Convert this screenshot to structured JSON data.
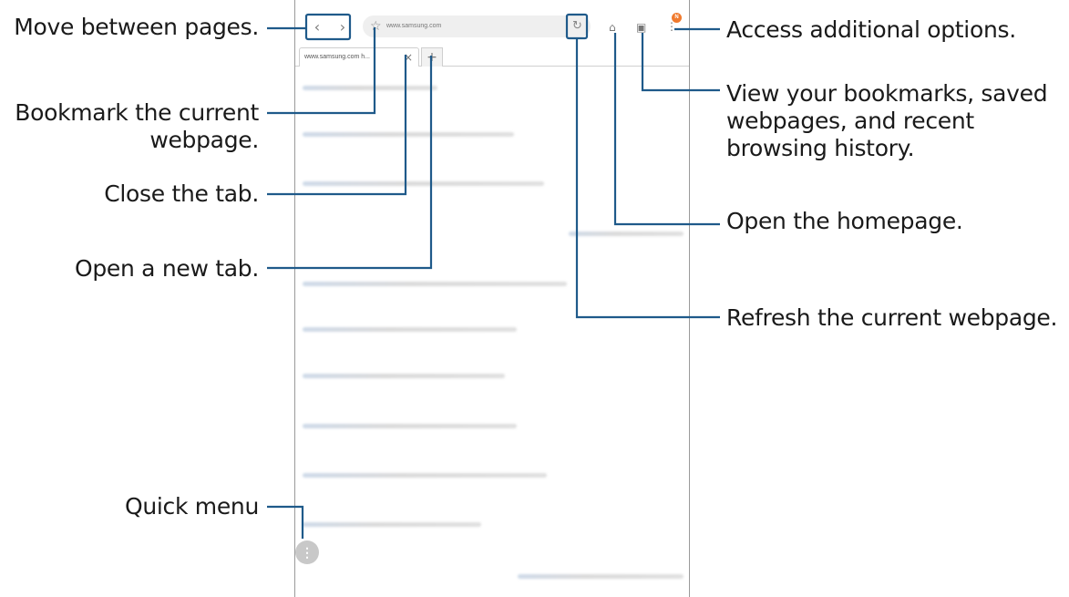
{
  "browser": {
    "url": "www.samsung.com",
    "tab_title": "www.samsung.com  h...",
    "new_tab_symbol": "+",
    "close_tab_symbol": "×",
    "badge_count": "N",
    "icons": [
      "back-icon",
      "forward-icon",
      "bookmark-star-icon",
      "refresh-icon",
      "home-icon",
      "bookmarks-icon",
      "more-options-icon",
      "quick-menu-icon"
    ]
  },
  "callouts": {
    "move_pages": "Move between pages.",
    "bookmark_line1": "Bookmark the current",
    "bookmark_line2": "webpage.",
    "close_tab": "Close the tab.",
    "open_new_tab": "Open a new tab.",
    "quick_menu": "Quick menu",
    "additional_options": "Access additional options.",
    "bookmarks_line1": "View your bookmarks, saved",
    "bookmarks_line2": "webpages, and recent",
    "bookmarks_line3": "browsing history.",
    "homepage": "Open the homepage.",
    "refresh": "Refresh the current webpage."
  },
  "colors": {
    "leader_line": "#1f5a8a",
    "badge": "#f07a2e",
    "frame": "#9a9a9a"
  }
}
